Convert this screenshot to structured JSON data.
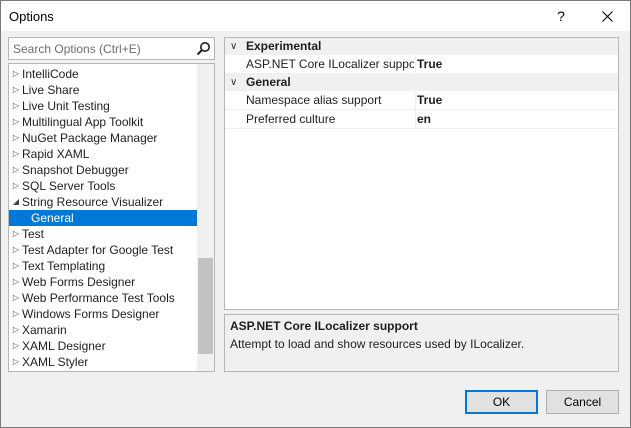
{
  "window": {
    "title": "Options",
    "help_glyph": "?"
  },
  "search": {
    "placeholder": "Search Options (Ctrl+E)"
  },
  "tree": {
    "items": [
      {
        "label": "IntelliCode",
        "arrow": "▷"
      },
      {
        "label": "Live Share",
        "arrow": "▷"
      },
      {
        "label": "Live Unit Testing",
        "arrow": "▷"
      },
      {
        "label": "Multilingual App Toolkit",
        "arrow": "▷"
      },
      {
        "label": "NuGet Package Manager",
        "arrow": "▷"
      },
      {
        "label": "Rapid XAML",
        "arrow": "▷"
      },
      {
        "label": "Snapshot Debugger",
        "arrow": "▷"
      },
      {
        "label": "SQL Server Tools",
        "arrow": "▷"
      },
      {
        "label": "String Resource Visualizer",
        "arrow": "◢"
      },
      {
        "label": "General",
        "arrow": ""
      },
      {
        "label": "Test",
        "arrow": "▷"
      },
      {
        "label": "Test Adapter for Google Test",
        "arrow": "▷"
      },
      {
        "label": "Text Templating",
        "arrow": "▷"
      },
      {
        "label": "Web Forms Designer",
        "arrow": "▷"
      },
      {
        "label": "Web Performance Test Tools",
        "arrow": "▷"
      },
      {
        "label": "Windows Forms Designer",
        "arrow": "▷"
      },
      {
        "label": "Xamarin",
        "arrow": "▷"
      },
      {
        "label": "XAML Designer",
        "arrow": "▷"
      },
      {
        "label": "XAML Styler",
        "arrow": "▷"
      }
    ]
  },
  "properties": {
    "categories": [
      {
        "name": "Experimental",
        "chevron": "∨",
        "rows": [
          {
            "name": "ASP.NET Core ILocalizer support",
            "value": "True"
          }
        ]
      },
      {
        "name": "General",
        "chevron": "∨",
        "rows": [
          {
            "name": "Namespace alias support",
            "value": "True"
          },
          {
            "name": "Preferred culture",
            "value": "en"
          }
        ]
      }
    ]
  },
  "description": {
    "title": "ASP.NET Core ILocalizer support",
    "text": "Attempt to load and show resources used by ILocalizer."
  },
  "buttons": {
    "ok": "OK",
    "cancel": "Cancel"
  },
  "colors": {
    "selection": "#0078d7",
    "default_button_border": "#0078d7"
  }
}
